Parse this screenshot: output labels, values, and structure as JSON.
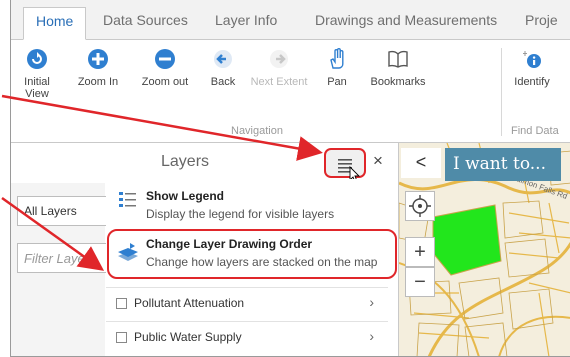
{
  "tabs": [
    {
      "label": "Home"
    },
    {
      "label": "Data Sources"
    },
    {
      "label": "Layer Info"
    },
    {
      "label": "Drawings and Measurements"
    },
    {
      "label": "Proje"
    }
  ],
  "ribbon": {
    "buttons": [
      {
        "label": "Initial View",
        "icon": "refresh-icon"
      },
      {
        "label": "Zoom In",
        "icon": "plus-circle-icon"
      },
      {
        "label": "Zoom out",
        "icon": "minus-circle-icon"
      },
      {
        "label": "Back",
        "icon": "arrow-left-icon"
      },
      {
        "label": "Next Extent",
        "icon": "arrow-right-icon"
      },
      {
        "label": "Pan",
        "icon": "hand-icon"
      },
      {
        "label": "Bookmarks",
        "icon": "book-icon"
      },
      {
        "label": "Identify",
        "icon": "info-icon"
      }
    ],
    "groups": {
      "navigation": "Navigation",
      "find_data": "Find Data"
    }
  },
  "panel": {
    "title": "Layers",
    "close": "×",
    "layer_filter_select": "All Layers",
    "filter_placeholder": "Filter Layers",
    "menu": [
      {
        "title": "Show Legend",
        "desc": "Display the legend for visible layers"
      },
      {
        "title": "Change Layer Drawing Order",
        "desc": "Change how layers are stacked on the map"
      }
    ],
    "layers": [
      {
        "label": "Pollutant Attenuation"
      },
      {
        "label": "Public Water Supply"
      }
    ]
  },
  "map": {
    "back": "<",
    "i_want_to": "I want to...",
    "zoom_in": "+",
    "zoom_out": "−",
    "street_label": "Salmon Falls Rd"
  },
  "colors": {
    "accent_blue": "#2a6fb7",
    "highlight_red": "#e0262a",
    "iwant_bg": "#4f8ba8",
    "map_green": "#22e61c"
  }
}
